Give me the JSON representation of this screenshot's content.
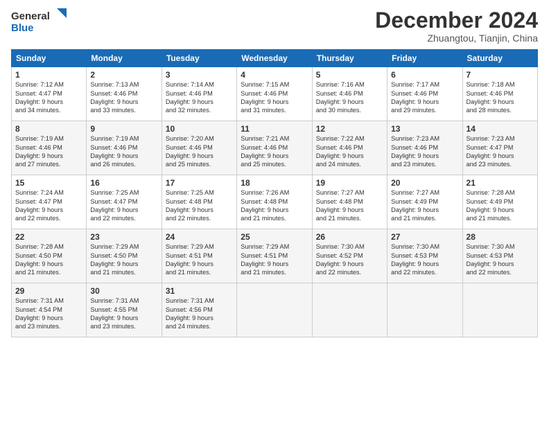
{
  "logo": {
    "line1": "General",
    "line2": "Blue"
  },
  "title": "December 2024",
  "subtitle": "Zhuangtou, Tianjin, China",
  "days_of_week": [
    "Sunday",
    "Monday",
    "Tuesday",
    "Wednesday",
    "Thursday",
    "Friday",
    "Saturday"
  ],
  "weeks": [
    [
      {
        "day": 1,
        "info": "Sunrise: 7:12 AM\nSunset: 4:47 PM\nDaylight: 9 hours\nand 34 minutes."
      },
      {
        "day": 2,
        "info": "Sunrise: 7:13 AM\nSunset: 4:46 PM\nDaylight: 9 hours\nand 33 minutes."
      },
      {
        "day": 3,
        "info": "Sunrise: 7:14 AM\nSunset: 4:46 PM\nDaylight: 9 hours\nand 32 minutes."
      },
      {
        "day": 4,
        "info": "Sunrise: 7:15 AM\nSunset: 4:46 PM\nDaylight: 9 hours\nand 31 minutes."
      },
      {
        "day": 5,
        "info": "Sunrise: 7:16 AM\nSunset: 4:46 PM\nDaylight: 9 hours\nand 30 minutes."
      },
      {
        "day": 6,
        "info": "Sunrise: 7:17 AM\nSunset: 4:46 PM\nDaylight: 9 hours\nand 29 minutes."
      },
      {
        "day": 7,
        "info": "Sunrise: 7:18 AM\nSunset: 4:46 PM\nDaylight: 9 hours\nand 28 minutes."
      }
    ],
    [
      {
        "day": 8,
        "info": "Sunrise: 7:19 AM\nSunset: 4:46 PM\nDaylight: 9 hours\nand 27 minutes."
      },
      {
        "day": 9,
        "info": "Sunrise: 7:19 AM\nSunset: 4:46 PM\nDaylight: 9 hours\nand 26 minutes."
      },
      {
        "day": 10,
        "info": "Sunrise: 7:20 AM\nSunset: 4:46 PM\nDaylight: 9 hours\nand 25 minutes."
      },
      {
        "day": 11,
        "info": "Sunrise: 7:21 AM\nSunset: 4:46 PM\nDaylight: 9 hours\nand 25 minutes."
      },
      {
        "day": 12,
        "info": "Sunrise: 7:22 AM\nSunset: 4:46 PM\nDaylight: 9 hours\nand 24 minutes."
      },
      {
        "day": 13,
        "info": "Sunrise: 7:23 AM\nSunset: 4:46 PM\nDaylight: 9 hours\nand 23 minutes."
      },
      {
        "day": 14,
        "info": "Sunrise: 7:23 AM\nSunset: 4:47 PM\nDaylight: 9 hours\nand 23 minutes."
      }
    ],
    [
      {
        "day": 15,
        "info": "Sunrise: 7:24 AM\nSunset: 4:47 PM\nDaylight: 9 hours\nand 22 minutes."
      },
      {
        "day": 16,
        "info": "Sunrise: 7:25 AM\nSunset: 4:47 PM\nDaylight: 9 hours\nand 22 minutes."
      },
      {
        "day": 17,
        "info": "Sunrise: 7:25 AM\nSunset: 4:48 PM\nDaylight: 9 hours\nand 22 minutes."
      },
      {
        "day": 18,
        "info": "Sunrise: 7:26 AM\nSunset: 4:48 PM\nDaylight: 9 hours\nand 21 minutes."
      },
      {
        "day": 19,
        "info": "Sunrise: 7:27 AM\nSunset: 4:48 PM\nDaylight: 9 hours\nand 21 minutes."
      },
      {
        "day": 20,
        "info": "Sunrise: 7:27 AM\nSunset: 4:49 PM\nDaylight: 9 hours\nand 21 minutes."
      },
      {
        "day": 21,
        "info": "Sunrise: 7:28 AM\nSunset: 4:49 PM\nDaylight: 9 hours\nand 21 minutes."
      }
    ],
    [
      {
        "day": 22,
        "info": "Sunrise: 7:28 AM\nSunset: 4:50 PM\nDaylight: 9 hours\nand 21 minutes."
      },
      {
        "day": 23,
        "info": "Sunrise: 7:29 AM\nSunset: 4:50 PM\nDaylight: 9 hours\nand 21 minutes."
      },
      {
        "day": 24,
        "info": "Sunrise: 7:29 AM\nSunset: 4:51 PM\nDaylight: 9 hours\nand 21 minutes."
      },
      {
        "day": 25,
        "info": "Sunrise: 7:29 AM\nSunset: 4:51 PM\nDaylight: 9 hours\nand 21 minutes."
      },
      {
        "day": 26,
        "info": "Sunrise: 7:30 AM\nSunset: 4:52 PM\nDaylight: 9 hours\nand 22 minutes."
      },
      {
        "day": 27,
        "info": "Sunrise: 7:30 AM\nSunset: 4:53 PM\nDaylight: 9 hours\nand 22 minutes."
      },
      {
        "day": 28,
        "info": "Sunrise: 7:30 AM\nSunset: 4:53 PM\nDaylight: 9 hours\nand 22 minutes."
      }
    ],
    [
      {
        "day": 29,
        "info": "Sunrise: 7:31 AM\nSunset: 4:54 PM\nDaylight: 9 hours\nand 23 minutes."
      },
      {
        "day": 30,
        "info": "Sunrise: 7:31 AM\nSunset: 4:55 PM\nDaylight: 9 hours\nand 23 minutes."
      },
      {
        "day": 31,
        "info": "Sunrise: 7:31 AM\nSunset: 4:56 PM\nDaylight: 9 hours\nand 24 minutes."
      },
      null,
      null,
      null,
      null
    ]
  ]
}
